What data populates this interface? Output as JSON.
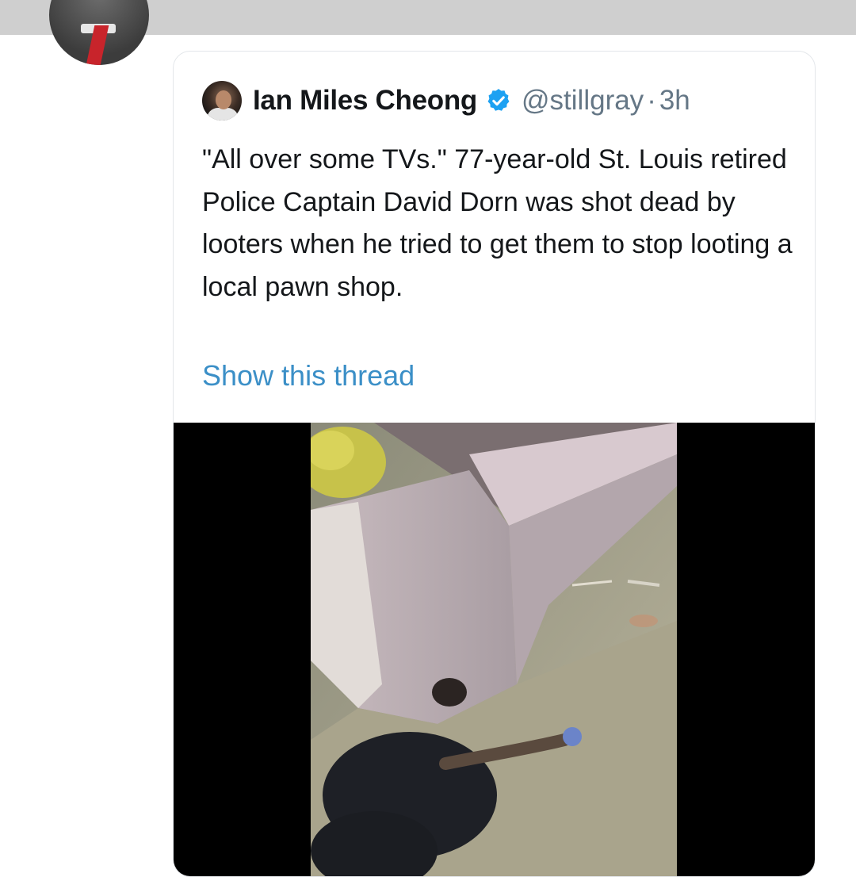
{
  "tweet": {
    "author_name": "Ian Miles Cheong",
    "handle": "@stillgray",
    "separator": "·",
    "timestamp": "3h",
    "text": "\"All over some TVs.\" 77-year-old St. Louis retired Police Captain David Dorn was shot dead by looters when he tried to get them to stop looting a local pawn shop.",
    "show_thread": "Show this thread"
  },
  "colors": {
    "link": "#3b8fc7",
    "verified": "#1da1f2",
    "secondary_text": "#657786"
  },
  "icons": [
    "avatar",
    "verified-badge-icon"
  ]
}
